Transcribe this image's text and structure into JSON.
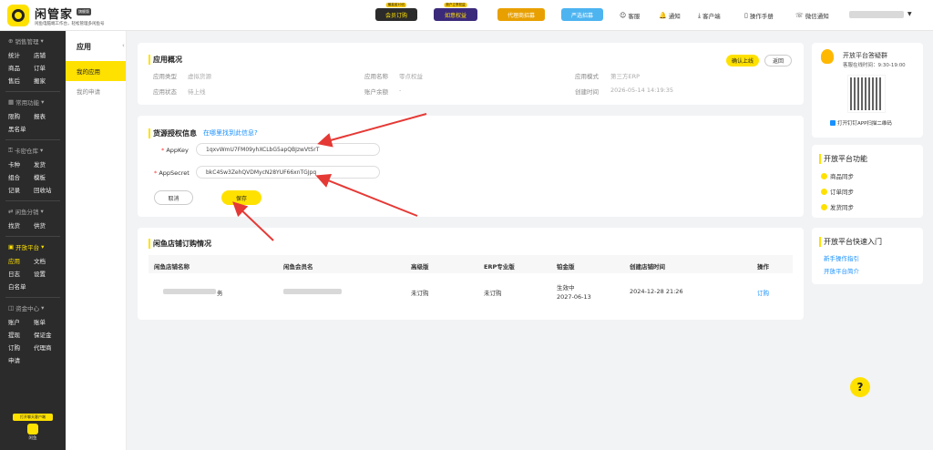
{
  "header": {
    "brand": "闲管家",
    "brand_badge": "旗舰版",
    "subtitle": "闲鱼电脑端工作台，轻松管理多闲鱼号",
    "buttons": [
      {
        "label": "会员订购",
        "tip": "最高省10元",
        "color": "#2b2b2b"
      },
      {
        "label": "如意权益",
        "tip": "新户立享权益",
        "color": "#3b2a7a"
      },
      {
        "label": "代理商招募",
        "tip": "",
        "color": "#e8a000"
      },
      {
        "label": "严选招募",
        "tip": "",
        "color": "#4db4f0"
      }
    ],
    "links": [
      {
        "icon": "☺",
        "label": "客服"
      },
      {
        "icon": "🔔",
        "label": "通知"
      },
      {
        "icon": "⤓",
        "label": "客户端"
      },
      {
        "icon": "▯",
        "label": "操作手册"
      },
      {
        "icon": "☏",
        "label": "微信通知"
      }
    ]
  },
  "sidebar": {
    "groups": [
      {
        "title": "销售管理",
        "rows": [
          [
            "统计",
            "店铺"
          ],
          [
            "商品",
            "订单"
          ],
          [
            "售后",
            "搬家"
          ]
        ]
      },
      {
        "title": "常用功能",
        "rows": [
          [
            "限购",
            "报表"
          ],
          [
            "黑名单"
          ]
        ]
      },
      {
        "title": "卡密仓库",
        "rows": [
          [
            "卡种",
            "发货"
          ],
          [
            "组合",
            "模板"
          ],
          [
            "记录",
            "回收站"
          ]
        ]
      },
      {
        "title": "闲鱼分销",
        "rows": [
          [
            "找货",
            "供货"
          ]
        ]
      },
      {
        "title": "开放平台",
        "active": true,
        "rows": [
          [
            "应用",
            "文档"
          ],
          [
            "日志",
            "设置"
          ],
          [
            "白名单"
          ]
        ]
      },
      {
        "title": "资金中心",
        "rows": [
          [
            "账户",
            "账单"
          ],
          [
            "提现",
            "保证金"
          ],
          [
            "订购",
            "代理商"
          ],
          [
            "申请"
          ]
        ]
      }
    ],
    "footer_badge": "打开聊天客户端",
    "footer_label": "闲鱼"
  },
  "subnav": {
    "title": "应用",
    "items": [
      "我的应用",
      "我的申请"
    ]
  },
  "overview": {
    "title": "应用概况",
    "confirm_label": "确认上线",
    "back_label": "返回",
    "fields": [
      {
        "label": "应用类型",
        "value": "虚拟货源"
      },
      {
        "label": "应用名称",
        "value": "零点权益"
      },
      {
        "label": "应用模式",
        "value": "第三方ERP"
      },
      {
        "label": "应用状态",
        "value": "待上线"
      },
      {
        "label": "账户余额",
        "value": "-"
      },
      {
        "label": "创建时间",
        "value": "2026-05-14 14:19:35"
      }
    ]
  },
  "auth": {
    "title": "货源授权信息",
    "help_link": "在哪里找到此信息?",
    "appkey_label": "AppKey",
    "appkey_value": "1qxvWmU7FM09yhXCLbG5apQBJzwVtSrT",
    "appsecret_label": "AppSecret",
    "appsecret_value": "bkC4Sw3ZehQVDMycN28YUF66xnTGJpq",
    "cancel_label": "取消",
    "save_label": "保存"
  },
  "orders": {
    "title": "闲鱼店铺订购情况",
    "headers": [
      "闲鱼店铺名称",
      "闲鱼会员名",
      "高级版",
      "ERP专业版",
      "铂金版",
      "创建店铺时间",
      "操作"
    ],
    "row": {
      "shop_suffix": "务",
      "advanced": "未订购",
      "erp": "未订购",
      "platinum_status": "生效中",
      "platinum_date": "2027-06-13",
      "created": "2024-12-28 21:26",
      "action": "订购"
    }
  },
  "right": {
    "group_title": "开放平台答疑群",
    "service_hours": "客服在线时间：9:30-19:00",
    "scan_tip": "打开钉钉APP扫描二维码",
    "func_title": "开放平台功能",
    "funcs": [
      "商品同步",
      "订单同步",
      "发货同步"
    ],
    "entry_title": "开放平台快速入门",
    "entries": [
      "新手操作指引",
      "开放平台简介"
    ]
  },
  "help_label": "?"
}
